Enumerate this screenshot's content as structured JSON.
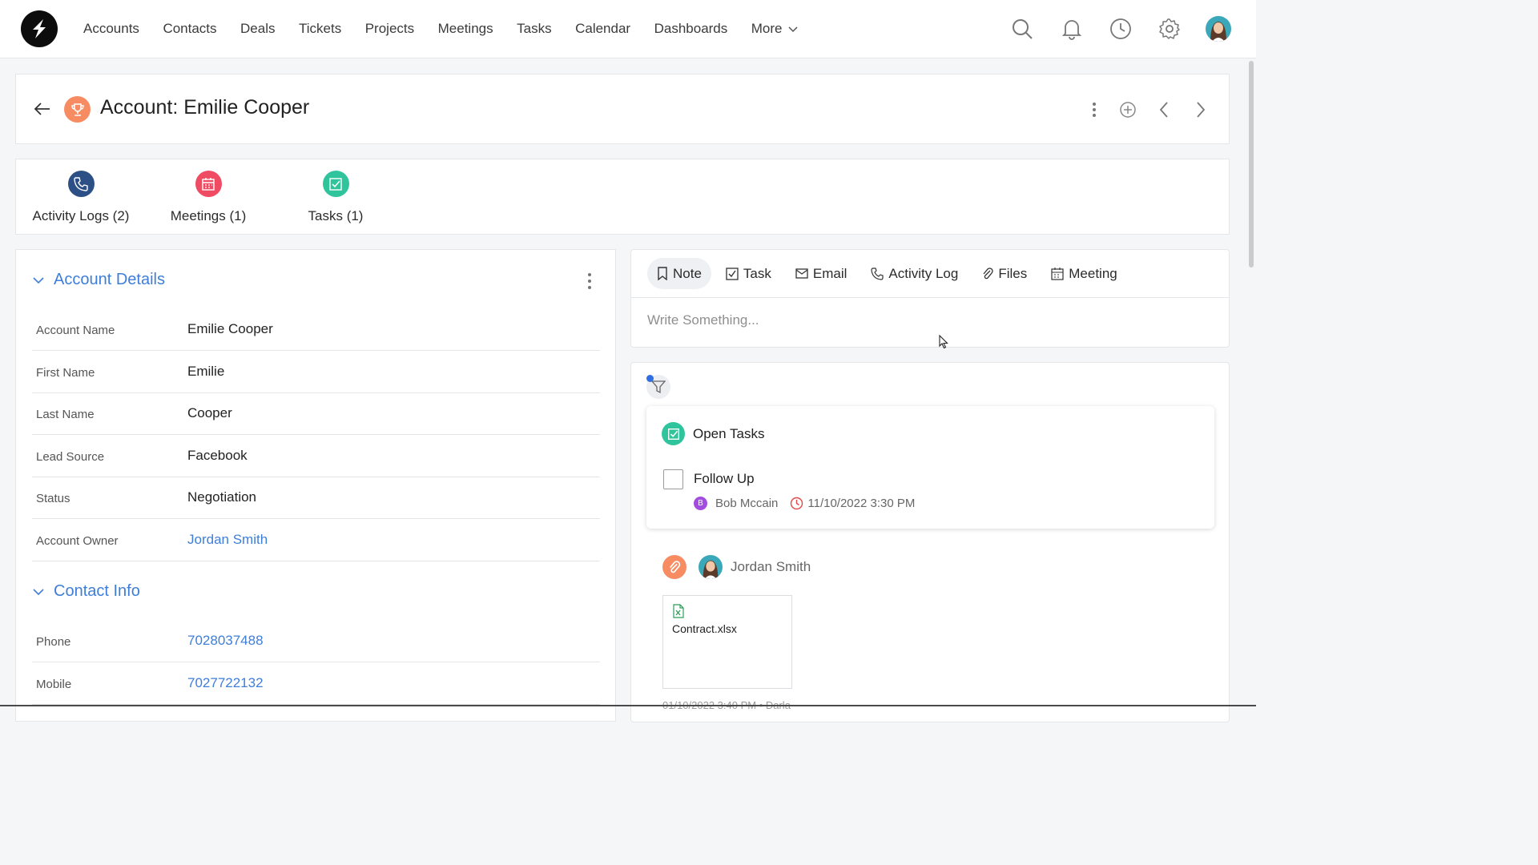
{
  "nav": {
    "items": [
      "Accounts",
      "Contacts",
      "Deals",
      "Tickets",
      "Projects",
      "Meetings",
      "Tasks",
      "Calendar",
      "Dashboards"
    ],
    "more_label": "More"
  },
  "header": {
    "title": "Account: Emilie Cooper"
  },
  "related": {
    "activity_logs": "Activity Logs (2)",
    "meetings": "Meetings (1)",
    "tasks": "Tasks (1)"
  },
  "details": {
    "section_title": "Account Details",
    "fields": [
      {
        "label": "Account Name",
        "value": "Emilie Cooper"
      },
      {
        "label": "First Name",
        "value": "Emilie"
      },
      {
        "label": "Last Name",
        "value": "Cooper"
      },
      {
        "label": "Lead Source",
        "value": "Facebook"
      },
      {
        "label": "Status",
        "value": "Negotiation"
      },
      {
        "label": "Account Owner",
        "value": "Jordan Smith"
      }
    ]
  },
  "contact": {
    "section_title": "Contact Info",
    "fields": [
      {
        "label": "Phone",
        "value": "7028037488"
      },
      {
        "label": "Mobile",
        "value": "7027722132"
      }
    ]
  },
  "composer": {
    "tabs": [
      "Note",
      "Task",
      "Email",
      "Activity Log",
      "Files",
      "Meeting"
    ],
    "placeholder": "Write Something..."
  },
  "timeline": {
    "open_tasks_title": "Open Tasks",
    "task": {
      "name": "Follow Up",
      "assignee_initial": "B",
      "assignee": "Bob Mccain",
      "due": "11/10/2022 3:30 PM"
    },
    "entry": {
      "user": "Jordan Smith",
      "file_name": "Contract.xlsx",
      "footer": "01/10/2022 3:40 PM  •  Darla"
    }
  },
  "colors": {
    "accent": "#3f7ed8",
    "account_icon": "#f78c62",
    "activity_logs": "#2c4f86",
    "meetings": "#ef4b62",
    "tasks": "#2fc49b",
    "assignee": "#a24ce0",
    "due": "#e04848"
  }
}
